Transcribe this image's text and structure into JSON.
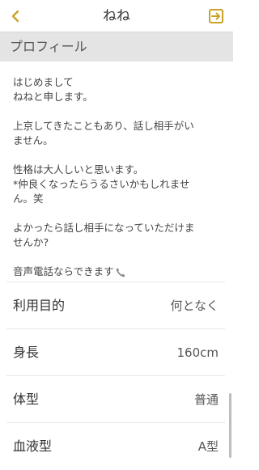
{
  "header": {
    "title": "ねね",
    "back_icon": "chevron-left-icon",
    "exit_icon": "exit-icon",
    "accent_color": "#c9a227"
  },
  "profile_section": {
    "title": "プロフィール"
  },
  "bio": {
    "paragraphs": [
      "はじめまして\nねねと申します。",
      "上京してきたこともあり、話し相手がい\nません。",
      "性格は大人しいと思います。\n*仲良くなったらうるさいかもしれませ\nん。笑",
      "よかったら話し相手になっていただけま\nせんか?",
      "音声電話ならできます"
    ],
    "trailing_icon": "phone-icon"
  },
  "details": [
    {
      "label": "利用目的",
      "value": "何となく"
    },
    {
      "label": "身長",
      "value": "160cm"
    },
    {
      "label": "体型",
      "value": "普通"
    },
    {
      "label": "血液型",
      "value": "A型"
    }
  ]
}
